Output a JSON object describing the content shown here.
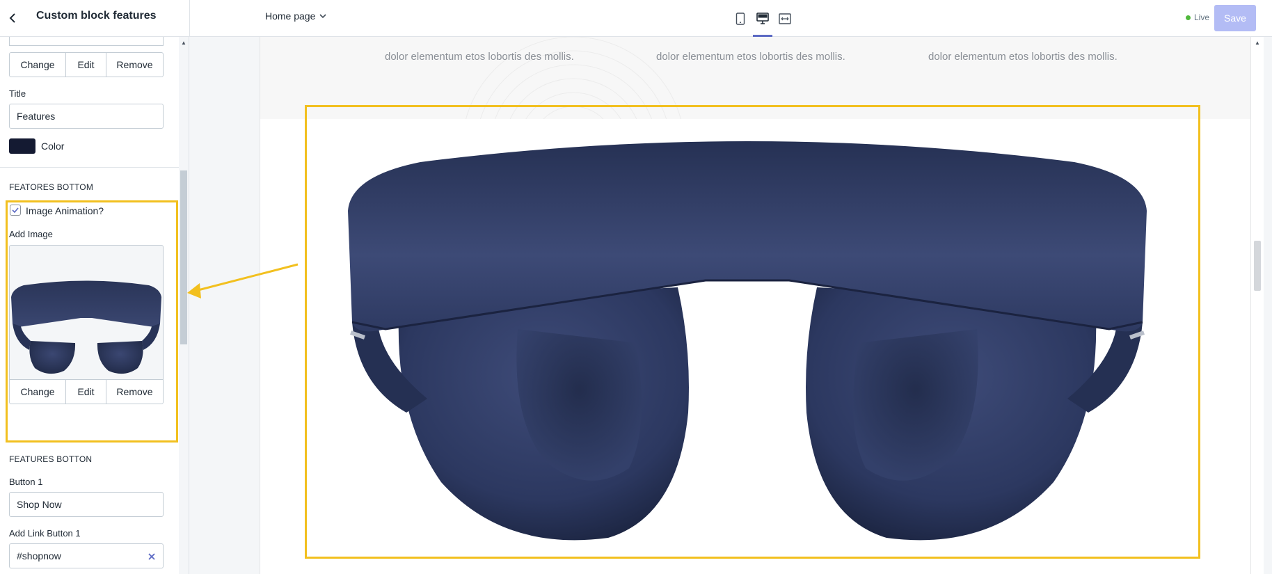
{
  "header": {
    "title": "Custom block features",
    "page_select": "Home page",
    "status": "Live",
    "save_label": "Save"
  },
  "sidebar": {
    "top_image_buttons": [
      "Change",
      "Edit",
      "Remove"
    ],
    "title_label": "Title",
    "title_value": "Features",
    "color_label": "Color",
    "color_value": "#141a32",
    "section_bottom": "FEATORES BOTTOM",
    "image_animation_label": "Image Animation?",
    "image_animation_checked": true,
    "add_image_label": "Add Image",
    "image_buttons": [
      "Change",
      "Edit",
      "Remove"
    ],
    "section_button": "FEATURES BOTTON",
    "button1_label": "Button 1",
    "button1_value": "Shop Now",
    "link1_label": "Add Link Button 1",
    "link1_value": "#shopnow"
  },
  "preview": {
    "feature_texts": [
      "dolor elementum etos lobortis des mollis.",
      "dolor elementum etos lobortis des mollis.",
      "dolor elementum etos lobortis des mollis."
    ]
  },
  "colors": {
    "accent": "#5c6ac4",
    "highlight": "#f2c01f",
    "headphone": "#2b3656"
  }
}
